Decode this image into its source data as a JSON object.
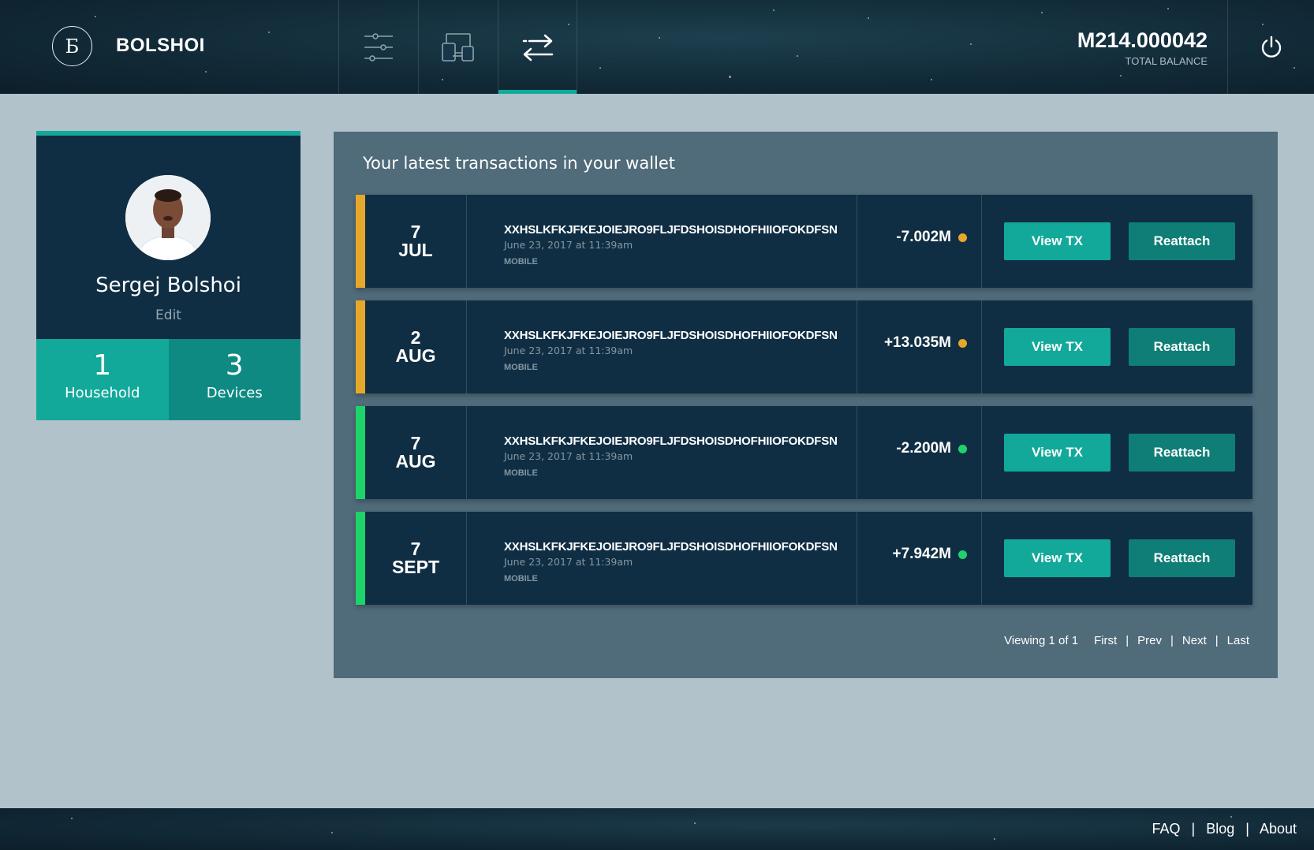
{
  "header": {
    "logo_glyph": "Б",
    "brand": "BOLSHOI",
    "nav": [
      {
        "icon": "sliders-icon",
        "active": false
      },
      {
        "icon": "devices-icon",
        "active": false
      },
      {
        "icon": "transfer-arrows-icon",
        "active": true
      }
    ],
    "balance_value": "M214.000042",
    "balance_label": "TOTAL BALANCE",
    "power_icon": "power-icon"
  },
  "profile": {
    "name": "Sergej Bolshoi",
    "edit_label": "Edit",
    "household_count": "1",
    "household_label": "Household",
    "devices_count": "3",
    "devices_label": "Devices"
  },
  "transactions": {
    "title": "Your latest transactions in your wallet",
    "rows": [
      {
        "day": "7",
        "month": "JUL",
        "hash": "XXHSLKFKJFKEJOIEJRO9FLJFDSHOISDHOFHIIOFOKDFSN",
        "time": "June 23, 2017 at 11:39am",
        "source": "MOBILE",
        "amount": "-7.002M",
        "status_color": "#e6a82b",
        "view_label": "View TX",
        "reattach_label": "Reattach"
      },
      {
        "day": "2",
        "month": "AUG",
        "hash": "XXHSLKFKJFKEJOIEJRO9FLJFDSHOISDHOFHIIOFOKDFSN",
        "time": "June 23, 2017 at 11:39am",
        "source": "MOBILE",
        "amount": "+13.035M",
        "status_color": "#e6a82b",
        "view_label": "View TX",
        "reattach_label": "Reattach"
      },
      {
        "day": "7",
        "month": "AUG",
        "hash": "XXHSLKFKJFKEJOIEJRO9FLJFDSHOISDHOFHIIOFOKDFSN",
        "time": "June 23, 2017 at 11:39am",
        "source": "MOBILE",
        "amount": "-2.200M",
        "status_color": "#1fd36b",
        "view_label": "View TX",
        "reattach_label": "Reattach"
      },
      {
        "day": "7",
        "month": "SEPT",
        "hash": "XXHSLKFKJFKEJOIEJRO9FLJFDSHOISDHOFHIIOFOKDFSN",
        "time": "June 23, 2017 at 11:39am",
        "source": "MOBILE",
        "amount": "+7.942M",
        "status_color": "#1fd36b",
        "view_label": "View TX",
        "reattach_label": "Reattach"
      }
    ],
    "pager": {
      "viewing": "Viewing 1 of 1",
      "first": "First",
      "prev": "Prev",
      "next": "Next",
      "last": "Last",
      "separator": "|"
    }
  },
  "footer": {
    "faq": "FAQ",
    "blog": "Blog",
    "about": "About",
    "separator": "|"
  },
  "colors": {
    "accent": "#12a99a",
    "accent_dark": "#0f7e76",
    "pending": "#e6a82b",
    "confirmed": "#1fd36b",
    "card_bg": "#102e43",
    "panel_bg": "#506b7a",
    "page_bg": "#b1c2cb"
  }
}
